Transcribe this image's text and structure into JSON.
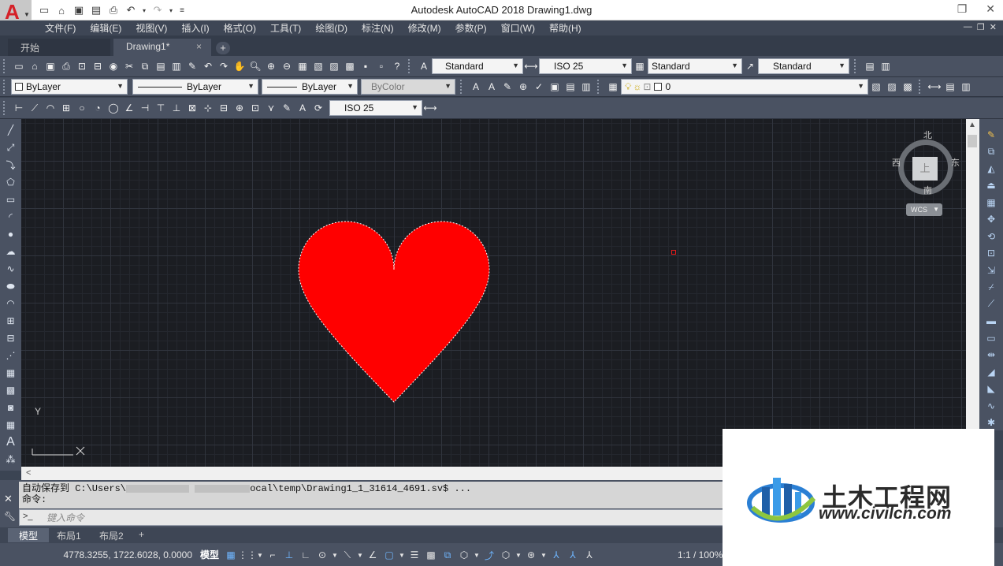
{
  "window": {
    "title": "Autodesk AutoCAD 2018    Drawing1.dwg",
    "logo_letter": "A"
  },
  "menu": [
    "文件(F)",
    "编辑(E)",
    "视图(V)",
    "插入(I)",
    "格式(O)",
    "工具(T)",
    "绘图(D)",
    "标注(N)",
    "修改(M)",
    "参数(P)",
    "窗口(W)",
    "帮助(H)"
  ],
  "doc_tabs": {
    "start": "开始",
    "drawing": "Drawing1*",
    "close_glyph": "×",
    "add_glyph": "+"
  },
  "toolbar1": {
    "text_style": "Standard",
    "dim_style": "ISO 25",
    "table_style": "Standard",
    "mleader_style": "Standard"
  },
  "toolbar2": {
    "color": "ByLayer",
    "linetype": "ByLayer",
    "lineweight": "ByLayer",
    "plotstyle": "ByColor",
    "layer": "0"
  },
  "toolbar3": {
    "dim_style": "ISO 25"
  },
  "viewcube": {
    "north": "北",
    "south": "南",
    "west": "西",
    "east": "东",
    "face": "上",
    "wcs": "WCS"
  },
  "ucs": {
    "y_label": "Y"
  },
  "colors": {
    "heart_fill": "#ff0000",
    "canvas_bg": "#1b1d22",
    "accent_blue": "#6fb6ff"
  },
  "command": {
    "history_line1_prefix": "自动保存到 C:\\Users\\",
    "history_line1_suffix": "ocal\\temp\\Drawing1_1_31614_4691.sv$ ...",
    "history_line2": "命令:",
    "input_placeholder": "键入命令",
    "prompt_glyph": ">_"
  },
  "layout_tabs": [
    "模型",
    "布局1",
    "布局2"
  ],
  "status": {
    "coordinates": "4778.3255, 1722.6028, 0.0000",
    "model_label": "模型",
    "annotation_scale": "1:1 / 100%"
  },
  "watermark": {
    "name": "土木工程网",
    "url": "www.civilcn.com"
  }
}
